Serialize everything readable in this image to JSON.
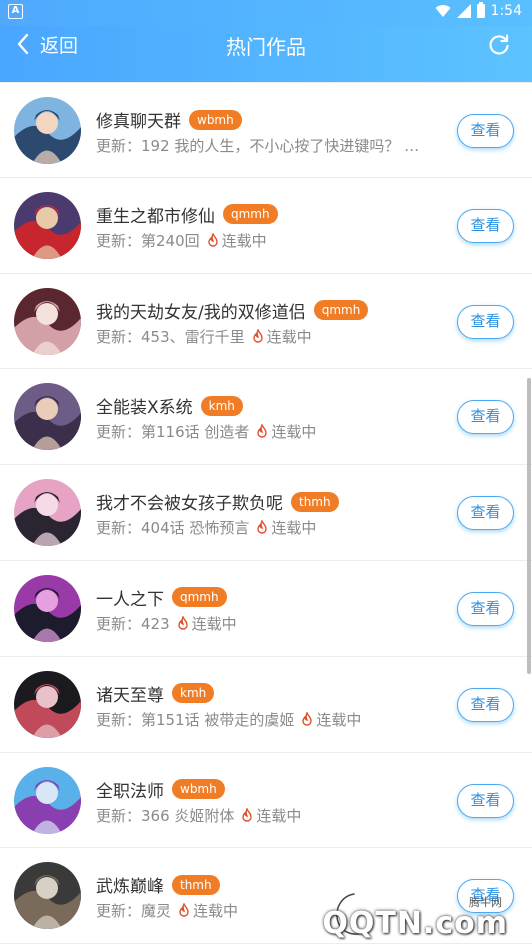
{
  "status_bar": {
    "app_badge": "A",
    "time": "1:54"
  },
  "nav": {
    "back_label": "返回",
    "title": "热门作品"
  },
  "view_label": "查看",
  "items": [
    {
      "title": "修真聊天群",
      "tag": "wbmh",
      "subtitle": "更新：192 我的人生，不小心按了快进键吗？",
      "status": "",
      "palette": [
        "#7fb4e0",
        "#2c4a70",
        "#f2d6c0"
      ]
    },
    {
      "title": "重生之都市修仙",
      "tag": "qmmh",
      "subtitle": "更新：第240回",
      "status": "连载中",
      "palette": [
        "#4b3a6e",
        "#c8262f",
        "#e8c9a8"
      ]
    },
    {
      "title": "我的天劫女友/我的双修道侣",
      "tag": "qmmh",
      "subtitle": "更新：453、雷行千里",
      "status": "连载中",
      "palette": [
        "#5a2730",
        "#d4a0a8",
        "#f5e2dc"
      ]
    },
    {
      "title": "全能装X系统",
      "tag": "kmh",
      "subtitle": "更新：第116话 创造者",
      "status": "连载中",
      "palette": [
        "#6c5c86",
        "#3b2f4c",
        "#e9cdb8"
      ]
    },
    {
      "title": "我才不会被女孩子欺负呢",
      "tag": "thmh",
      "subtitle": "更新：404话 恐怖预言",
      "status": "连载中",
      "palette": [
        "#e7a3c4",
        "#2a2530",
        "#f6dbe6"
      ]
    },
    {
      "title": "一人之下",
      "tag": "qmmh",
      "subtitle": "更新：423",
      "status": "连载中",
      "palette": [
        "#9a3aa8",
        "#1d1b2e",
        "#e6a0e0"
      ]
    },
    {
      "title": "诸天至尊",
      "tag": "kmh",
      "subtitle": "更新：第151话 被带走的虞姬",
      "status": "连载中",
      "palette": [
        "#1a1a1f",
        "#c04a5a",
        "#e8c2c8"
      ]
    },
    {
      "title": "全职法师",
      "tag": "wbmh",
      "subtitle": "更新：366 炎姬附体",
      "status": "连载中",
      "palette": [
        "#5ab0e8",
        "#8a3fb0",
        "#d9e6f6"
      ]
    },
    {
      "title": "武炼巅峰",
      "tag": "thmh",
      "subtitle": "更新：魔灵",
      "status": "连载中",
      "palette": [
        "#3a3a3a",
        "#7a6a5a",
        "#d8d0c4"
      ]
    }
  ],
  "watermark": {
    "cn": "腾牛网",
    "brand": "QQTN.com"
  }
}
